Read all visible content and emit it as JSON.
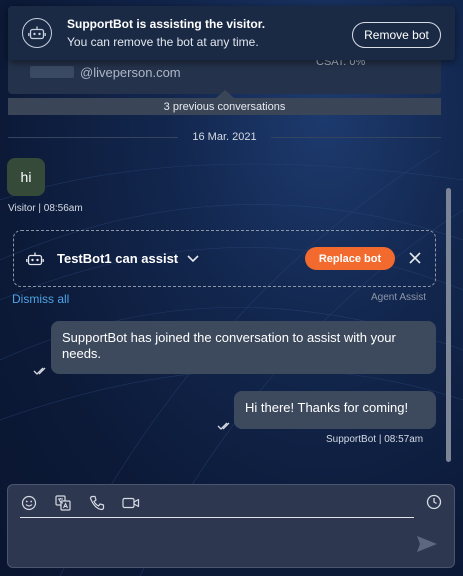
{
  "banner": {
    "title": "SupportBot is assisting the visitor.",
    "subtitle": "You can remove the bot at any time.",
    "remove_label": "Remove bot"
  },
  "previous": {
    "email": "@liveperson.com",
    "csat": "CSAT: 0%",
    "count_label": "3 previous conversations"
  },
  "date_divider": "16 Mar. 2021",
  "visitor_message": {
    "text": "hi",
    "meta": "Visitor | 08:56am"
  },
  "suggestion": {
    "title": "TestBot1 can assist",
    "replace_label": "Replace bot",
    "dismiss_label": "Dismiss all",
    "source_label": "Agent Assist"
  },
  "messages": [
    {
      "text": "SupportBot has joined the conversation to assist with your needs."
    },
    {
      "text": "Hi there! Thanks for coming!"
    }
  ],
  "bot_meta": "SupportBot | 08:57am",
  "composer": {
    "tools": [
      "emoji-icon",
      "translate-icon",
      "phone-icon",
      "video-icon"
    ],
    "schedule_icon": "clock-icon",
    "send_icon": "send-icon"
  },
  "colors": {
    "accent": "#f26a2e",
    "link": "#4fa3e5",
    "bubble": "#3d4a5e",
    "visitor_bubble": "#364a3a"
  }
}
